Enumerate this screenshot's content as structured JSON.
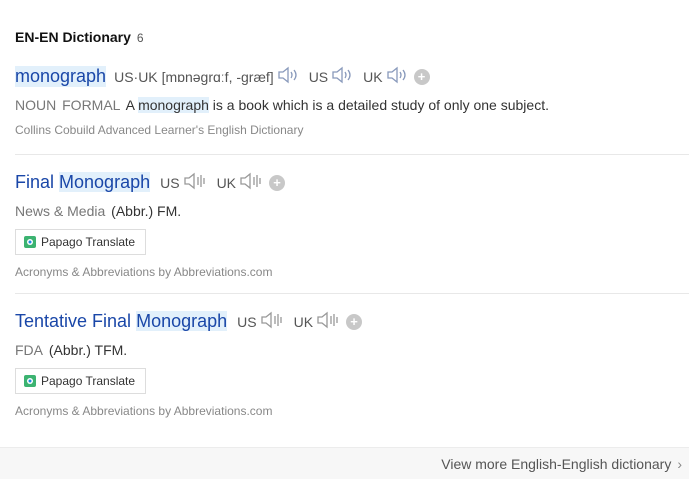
{
  "section": {
    "title": "EN-EN Dictionary",
    "count": "6"
  },
  "entries": [
    {
      "headword": "monograph",
      "pron_label": "US·UK",
      "pron_ipa": "[mɒnəgrɑːf, -græf]",
      "audio1": "US",
      "audio2": "UK",
      "pos1": "NOUN",
      "pos2": "FORMAL",
      "def_pre": "A",
      "def_hl": "monograph",
      "def_post": "is a book which is a detailed study of only one subject.",
      "source": "Collins Cobuild Advanced Learner's English Dictionary"
    },
    {
      "headword_pre": "Final",
      "headword_hl": "Monograph",
      "audio1": "US",
      "audio2": "UK",
      "pos1": "News & Media",
      "def": "(Abbr.) FM.",
      "papago": "Papago Translate",
      "source": "Acronyms & Abbreviations by Abbreviations.com"
    },
    {
      "headword_pre": "Tentative Final",
      "headword_hl": "Monograph",
      "audio1": "US",
      "audio2": "UK",
      "pos1": "FDA",
      "def": "(Abbr.) TFM.",
      "papago": "Papago Translate",
      "source": "Acronyms & Abbreviations by Abbreviations.com"
    }
  ],
  "footer": {
    "link": "View more English-English dictionary"
  },
  "colors": {
    "headword": "#1a47a8",
    "highlight": "#e2f0fb"
  }
}
